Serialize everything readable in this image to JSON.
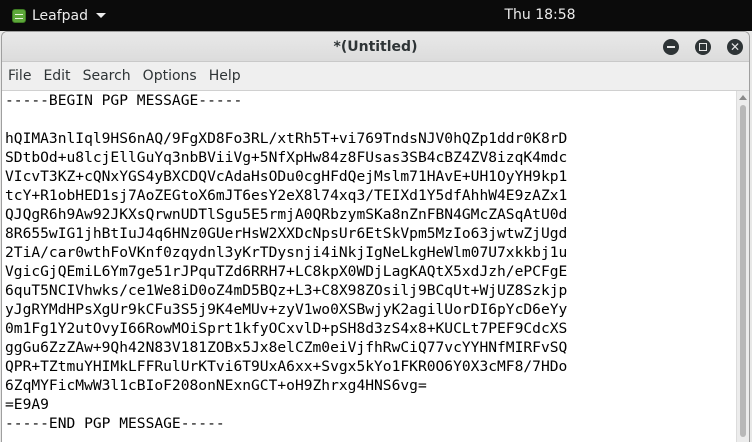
{
  "topbar": {
    "app_name": "Leafpad",
    "clock": "Thu 18:58"
  },
  "window": {
    "title": "*(Untitled)"
  },
  "menubar": {
    "items": [
      "File",
      "Edit",
      "Search",
      "Options",
      "Help"
    ]
  },
  "editor": {
    "lines": [
      "-----BEGIN PGP MESSAGE-----",
      "",
      "hQIMA3nlIql9HS6nAQ/9FgXD8Fo3RL/xtRh5T+vi769TndsNJV0hQZp1ddr0K8rD",
      "SDtbOd+u8lcjEllGuYq3nbBViiVg+5NfXpHw84z8FUsas3SB4cBZ4ZV8izqK4mdc",
      "VIcvT3KZ+cQNxYGS4yBXCDQVcAdaHsODu0cgHFdQejMslm71HAvE+UH1OyYH9kp1",
      "tcY+R1obHED1sj7AoZEGtoX6mJT6esY2eX8l74xq3/TEIXd1Y5dfAhhW4E9zAZx1",
      "QJQgR6h9Aw92JKXsQrwnUDTlSgu5E5rmjA0QRbzymSKa8nZnFBN4GMcZASqAtU0d",
      "8R655wIG1jhBtIuJ4q6HNz0GUerHsW2XXDcNpsUr6EtSkVpm5MzIo63jwtwZjUgd",
      "2TiA/car0wthFoVKnf0zqydnl3yKrTDysnji4iNkjIgNeLkgHeWlm07U7xkkbj1u",
      "VgicGjQEmiL6Ym7ge51rJPquTZd6RRH7+LC8kpX0WDjLagKAQtX5xdJzh/ePCFgE",
      "6quT5NCIVhwks/ce1We8iD0oZ4mD5BQz+L3+C8X98ZOsilj9BCqUt+WjUZ8Szkjp",
      "yJgRYMdHPsXgUr9kCFu3S5j9K4eMUv+zyV1wo0XSBwjyK2agilUorDI6pYcD6eYy",
      "0m1Fg1Y2utOvyI66RowMOiSprt1kfyOCxvlD+pSH8d3zS4x8+KUCLt7PEF9CdcXS",
      "ggGu6ZzZAw+9Qh42N83V181ZOBx5Jx8elCZm0eiVjfhRwCiQ77vcYYHNfMIRFvSQ",
      "QPR+TZtmuYHIMkLFFRulUrKTvi6T9UxA6xx+Svgx5kYo1FKR0O6Y0X3cMF8/7HDo",
      "6ZqMYFicMwW3l1cBIoF208onNExnGCT+oH9Zhrxg4HNS6vg=",
      "=E9A9",
      "-----END PGP MESSAGE-----"
    ]
  }
}
